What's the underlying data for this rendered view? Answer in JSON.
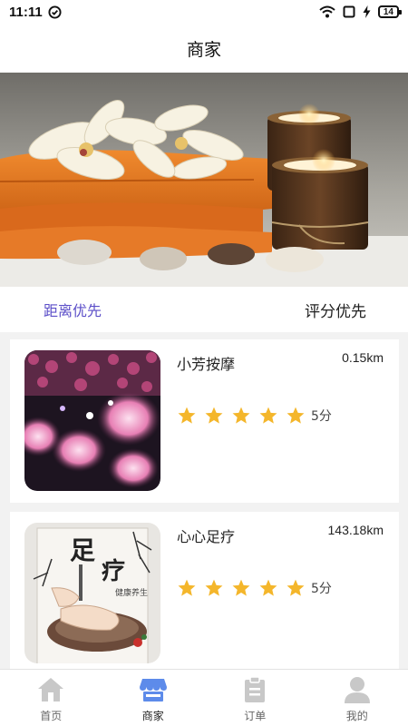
{
  "status_bar": {
    "time": "11:11",
    "battery": "14"
  },
  "header": {
    "title": "商家"
  },
  "sort": {
    "tabs": [
      {
        "label": "距离优先",
        "active": true
      },
      {
        "label": "评分优先",
        "active": false
      }
    ]
  },
  "shops": [
    {
      "name": "小芳按摩",
      "distance": "0.15km",
      "stars": 5,
      "score": "5分"
    },
    {
      "name": "心心足疗",
      "distance": "143.18km",
      "stars": 5,
      "score": "5分"
    }
  ],
  "nav": {
    "items": [
      {
        "label": "首页",
        "icon": "home-icon",
        "active": false
      },
      {
        "label": "商家",
        "icon": "shop-icon",
        "active": true
      },
      {
        "label": "订单",
        "icon": "order-icon",
        "active": false
      },
      {
        "label": "我的",
        "icon": "user-icon",
        "active": false
      }
    ]
  },
  "colors": {
    "accent": "#5b4ec8",
    "star": "#f4b62b",
    "nav_active": "#5d8bea",
    "nav_inactive": "#c8c8c8"
  }
}
